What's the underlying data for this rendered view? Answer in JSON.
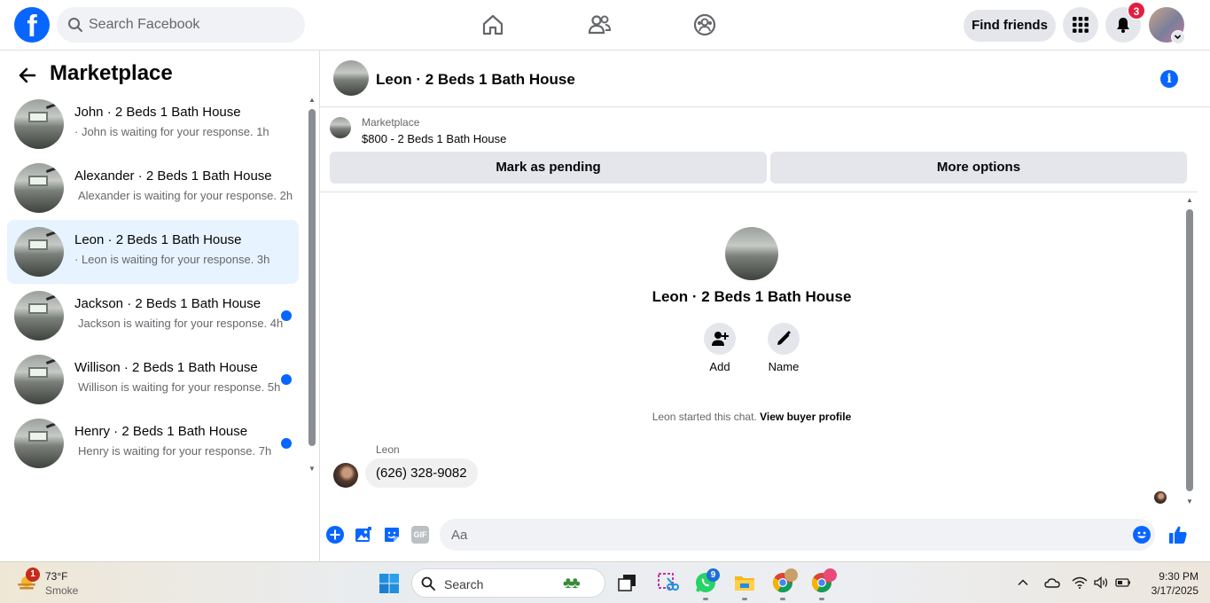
{
  "topbar": {
    "logo": "f",
    "search_placeholder": "Search Facebook",
    "find_friends": "Find friends",
    "notification_count": "3",
    "icons": [
      "home-icon",
      "friends-icon",
      "groups-icon",
      "menu-grid-icon",
      "bell-icon"
    ]
  },
  "sidebar": {
    "title": "Marketplace",
    "threads": [
      {
        "title": "John · 2 Beds 1 Bath House",
        "subtitle": "· John is waiting for your response. 1h",
        "unread": false,
        "active": false
      },
      {
        "title": "Alexander · 2 Beds 1 Bath House",
        "subtitle": "Alexander is waiting for your response. 2h",
        "unread": false,
        "active": false
      },
      {
        "title": "Leon · 2 Beds 1 Bath House",
        "subtitle": "· Leon is waiting for your response. 3h",
        "unread": false,
        "active": true
      },
      {
        "title": "Jackson · 2 Beds 1 Bath House",
        "subtitle": "Jackson is waiting for your response. 4h",
        "unread": true,
        "active": false
      },
      {
        "title": "Willison · 2 Beds 1 Bath House",
        "subtitle": "Willison is waiting for your response. 5h",
        "unread": true,
        "active": false
      },
      {
        "title": "Henry · 2 Beds 1 Bath House",
        "subtitle": "Henry is waiting for your response. 7h",
        "unread": true,
        "active": false
      }
    ]
  },
  "chat": {
    "header_title": "Leon · 2 Beds 1 Bath House",
    "listing_category": "Marketplace",
    "listing_price": "$800 - 2 Beds 1 Bath House",
    "mark_pending": "Mark as pending",
    "more_options": "More options",
    "profile_title": "Leon · 2 Beds 1 Bath House",
    "action_add": "Add",
    "action_name": "Name",
    "started_text": "Leon started this chat.",
    "view_profile": "View buyer profile",
    "sender": "Leon",
    "message": "(626) 328-9082",
    "composer_placeholder": "Aa",
    "gif_label": "GIF"
  },
  "taskbar": {
    "weather_badge": "1",
    "temperature": "73°F",
    "weather": "Smoke",
    "search": "Search",
    "whatsapp_badge": "9",
    "time": "9:30 PM",
    "date": "3/17/2025"
  },
  "colors": {
    "accent": "#0866ff",
    "active_thread": "#e7f3ff",
    "badge": "#e41e3f"
  }
}
